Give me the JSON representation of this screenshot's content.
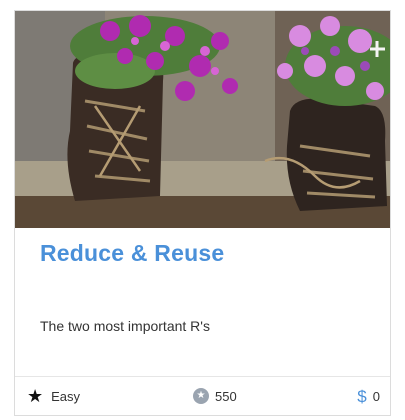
{
  "card": {
    "title": "Reduce & Reuse",
    "description": "The two most important R's",
    "difficulty": "Easy",
    "points": "550",
    "cost": "0"
  },
  "icons": {
    "difficulty": "star-icon",
    "points": "star-badge-icon",
    "cost": "dollar-icon"
  },
  "colors": {
    "title": "#4a90d9",
    "dollar": "#4a90d9"
  }
}
